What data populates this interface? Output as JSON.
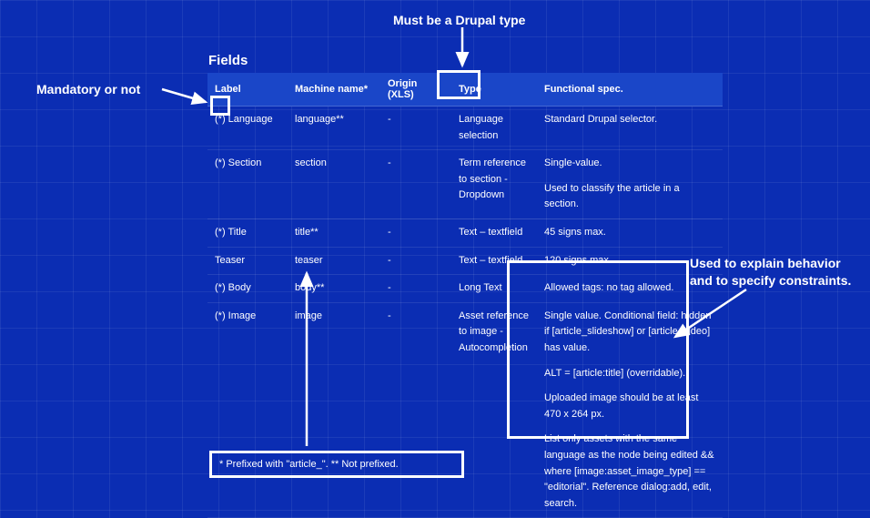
{
  "title": "Fields",
  "columns": {
    "label": "Label",
    "machine_name": "Machine name*",
    "origin": "Origin (XLS)",
    "type": "Type",
    "func": "Functional spec."
  },
  "rows": [
    {
      "label": "(*) Language",
      "machine_name": "language**",
      "origin": "-",
      "type": "Language selection",
      "func": [
        "Standard Drupal selector."
      ]
    },
    {
      "label": "(*) Section",
      "machine_name": "section",
      "origin": "-",
      "type": "Term reference to section - Dropdown",
      "func": [
        "Single-value.",
        "Used to classify the article in a section."
      ]
    },
    {
      "label": "(*) Title",
      "machine_name": "title**",
      "origin": "-",
      "type": "Text – textfield",
      "func": [
        "45 signs max."
      ]
    },
    {
      "label": "Teaser",
      "machine_name": "teaser",
      "origin": "-",
      "type": "Text – textfield",
      "func": [
        "120 signs max."
      ]
    },
    {
      "label": "(*) Body",
      "machine_name": "body**",
      "origin": "-",
      "type": "Long Text",
      "func": [
        "Allowed tags: no tag allowed."
      ]
    },
    {
      "label": "(*) Image",
      "machine_name": "image",
      "origin": "-",
      "type": "Asset reference to image - Autocompletion",
      "func": [
        "Single value. Conditional field: hidden if [article_slideshow] or [article_video] has value.",
        "ALT = [article:title] (overridable).",
        "Uploaded image should be at least 470 x 264 px.",
        "List only assets with the same language as the node being edited && where [image:asset_image_type] == \"editorial\". Reference dialog:add, edit, search."
      ]
    }
  ],
  "footnote": "* Prefixed with \"article_\". ** Not prefixed.",
  "annotations": {
    "mandatory": "Mandatory or not",
    "drupal_type": "Must be a Drupal type",
    "func_note": "Used to explain behavior and to specify constraints."
  }
}
